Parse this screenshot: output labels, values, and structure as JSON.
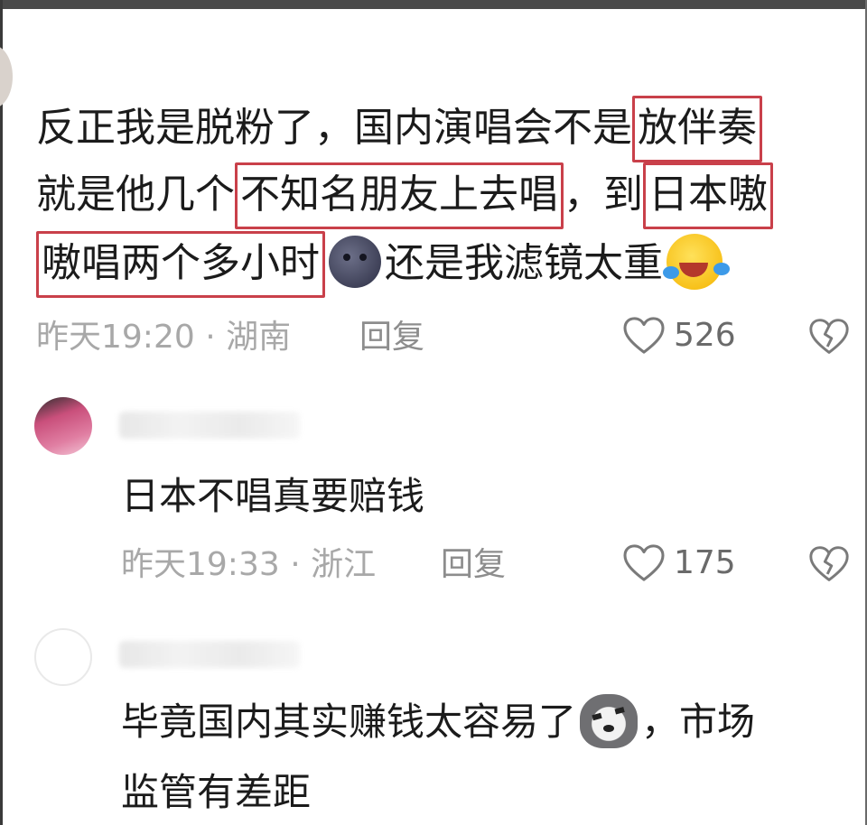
{
  "comments": [
    {
      "text_parts": {
        "line1_a": "反正我是脱粉了，国内演唱会不是",
        "line1_hl": "放伴奏",
        "line2_a": "就是他几个",
        "line2_hl1": "不知名朋友上去唱",
        "line2_b": "，到",
        "line2_hl2": "日本嗷",
        "line3_hl": "嗷唱两个多小时",
        "line3_b": "还是我滤镜太重"
      },
      "emojis": [
        "moon-face",
        "laughing-crying"
      ],
      "meta": "昨天19:20 · 湖南",
      "reply_label": "回复",
      "likes": "526"
    },
    {
      "author": "",
      "text": "日本不唱真要赔钱",
      "meta": "昨天19:33 · 浙江",
      "reply_label": "回复",
      "likes": "175"
    },
    {
      "author": "",
      "text_line1": "毕竟国内其实赚钱太容易了",
      "text_line1_after": "，市场",
      "text_line2": "监管有差距",
      "emojis": [
        "doge"
      ]
    }
  ],
  "colors": {
    "highlight_border": "#c9404a",
    "meta_text": "#a8a8a8",
    "like_count": "#6a6a6a"
  },
  "icons": [
    "heart-outline-icon",
    "broken-heart-icon"
  ]
}
